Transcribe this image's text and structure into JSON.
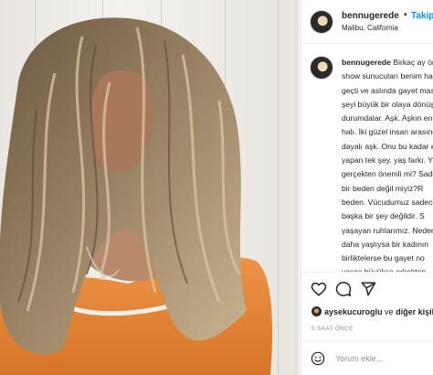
{
  "post": {
    "username": "bennugerede",
    "follow_label": "Takip",
    "dot": "•",
    "location": "Malibu, California"
  },
  "caption": {
    "username": "bennugerede",
    "text": "Birkaç ay önce bir talk show sunucuları benim hakkımda konuş\ngeçti ve aslında gayet masum olan bi\nşeyi büyük bir olaya dönüştürüp ne\ndurumdalar. Aşk. Aşkın en güzel, en\nhalı. İki güzel insan arasında samimi\ndayalı aşk. Onu bu kadar eleştirme\nyapan tek şey. yaş farkı. Yaş farkı\ngerçekten önemli mi? Sadece yaşla\nbir beden değil miyiz?R\nbeden. Vücudumuz sadece bir\nbaşka bir şey değildir. S\nyaşayan ruhlarımız. Neden\ndaha yaşlıysa bir kadının\nbirliktelerse bu gayet no\nyaşça büyükse erkekten\nskandaldır? Bu sana nası\nediyor? Yolları kesişen v\nbir yolculuk yaşayan iki"
  },
  "likes": {
    "user": "aysekucuroglu",
    "connector": "ve",
    "others": "diğer kişiler"
  },
  "timestamp": "5 SAAT ÖNCE",
  "comment": {
    "placeholder": "Yorum ekle..."
  },
  "icons": {
    "like": "heart-icon",
    "comment": "comment-icon",
    "share": "paper-plane-icon",
    "emoji": "smiley-icon"
  },
  "colors": {
    "follow": "#0095f6",
    "text": "#262626",
    "muted": "#8e8e8e",
    "border": "#dbdbdb",
    "sweater": "#e88a3a"
  }
}
